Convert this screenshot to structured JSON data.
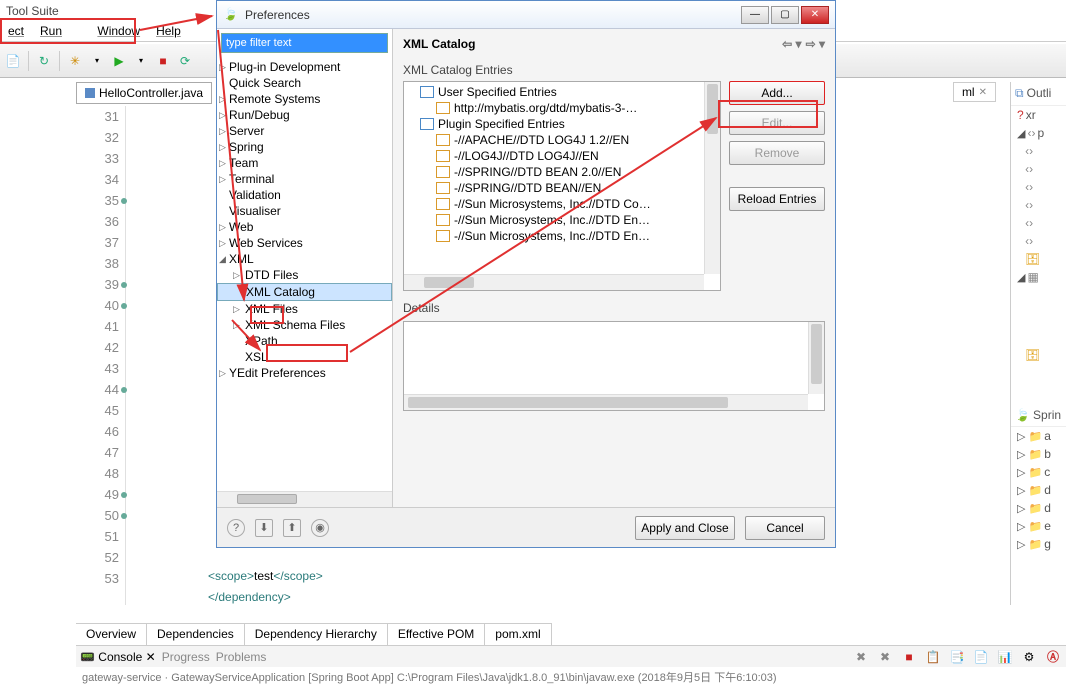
{
  "window": {
    "title": "Tool Suite"
  },
  "menu": [
    "ect",
    "Run",
    "Window",
    "Help"
  ],
  "editor_tab": "HelloController.java",
  "right_tab": "ml",
  "line_numbers": [
    "31",
    "32",
    "33",
    "34",
    "35",
    "36",
    "37",
    "38",
    "39",
    "40",
    "41",
    "42",
    "43",
    "44",
    "45",
    "46",
    "47",
    "48",
    "49",
    "50",
    "51",
    "52",
    "53"
  ],
  "marked_lines": [
    "35",
    "39",
    "40",
    "44",
    "49",
    "50"
  ],
  "code": {
    "l52": {
      "open": "<scope>",
      "txt": "test",
      "close": "</scope>"
    },
    "l53": "</dependency>"
  },
  "bottom_tabs": [
    "Overview",
    "Dependencies",
    "Dependency Hierarchy",
    "Effective POM",
    "pom.xml"
  ],
  "console_tabs": [
    "Console",
    "Progress",
    "Problems"
  ],
  "console_status": "gateway-service · GatewayServiceApplication [Spring Boot App] C:\\Program Files\\Java\\jdk1.8.0_91\\bin\\javaw.exe (2018年9月5日 下午6:10:03)",
  "outline": {
    "title": "Outli",
    "root": "xr",
    "items": [
      "p",
      "‹›",
      "‹›",
      "‹›",
      "‹›",
      "‹›",
      "‹›",
      "‹›"
    ]
  },
  "spring_panel": {
    "title": "Sprin",
    "items": [
      "a",
      "b",
      "c",
      "d",
      "d",
      "e",
      "g"
    ]
  },
  "dialog": {
    "title": "Preferences",
    "filter_text": "type filter text",
    "heading": "XML Catalog",
    "section_entries": "XML Catalog Entries",
    "section_details": "Details",
    "tree": [
      {
        "l": 1,
        "a": "▷",
        "t": "Plug-in Development"
      },
      {
        "l": 1,
        "a": "",
        "t": "Quick Search"
      },
      {
        "l": 1,
        "a": "▷",
        "t": "Remote Systems"
      },
      {
        "l": 1,
        "a": "▷",
        "t": "Run/Debug"
      },
      {
        "l": 1,
        "a": "▷",
        "t": "Server"
      },
      {
        "l": 1,
        "a": "▷",
        "t": "Spring"
      },
      {
        "l": 1,
        "a": "▷",
        "t": "Team"
      },
      {
        "l": 1,
        "a": "▷",
        "t": "Terminal"
      },
      {
        "l": 1,
        "a": "",
        "t": "Validation"
      },
      {
        "l": 1,
        "a": "",
        "t": "Visualiser"
      },
      {
        "l": 1,
        "a": "▷",
        "t": "Web"
      },
      {
        "l": 1,
        "a": "▷",
        "t": "Web Services"
      },
      {
        "l": 1,
        "a": "◢",
        "t": "XML",
        "anno": true
      },
      {
        "l": 2,
        "a": "▷",
        "t": "DTD Files"
      },
      {
        "l": 2,
        "a": "",
        "t": "XML Catalog",
        "sel": true,
        "anno": true
      },
      {
        "l": 2,
        "a": "▷",
        "t": "XML Files"
      },
      {
        "l": 2,
        "a": "▷",
        "t": "XML Schema Files"
      },
      {
        "l": 2,
        "a": "",
        "t": "XPath"
      },
      {
        "l": 2,
        "a": "",
        "t": "XSL"
      },
      {
        "l": 1,
        "a": "▷",
        "t": "YEdit Preferences"
      }
    ],
    "entries": [
      {
        "l": 1,
        "a": "◢",
        "ico": "folder",
        "t": "User Specified Entries"
      },
      {
        "l": 2,
        "ico": "doc",
        "t": "http://mybatis.org/dtd/mybatis-3-…"
      },
      {
        "l": 1,
        "a": "◢",
        "ico": "folder",
        "t": "Plugin Specified Entries"
      },
      {
        "l": 2,
        "ico": "doc",
        "t": "-//APACHE//DTD LOG4J 1.2//EN"
      },
      {
        "l": 2,
        "ico": "doc",
        "t": "-//LOG4J//DTD LOG4J//EN"
      },
      {
        "l": 2,
        "ico": "doc",
        "t": "-//SPRING//DTD BEAN 2.0//EN"
      },
      {
        "l": 2,
        "ico": "doc",
        "t": "-//SPRING//DTD BEAN//EN"
      },
      {
        "l": 2,
        "ico": "doc",
        "t": "-//Sun Microsystems, Inc.//DTD Co…"
      },
      {
        "l": 2,
        "ico": "doc",
        "t": "-//Sun Microsystems, Inc.//DTD En…"
      },
      {
        "l": 2,
        "ico": "doc",
        "t": "-//Sun Microsystems, Inc.//DTD En…"
      }
    ],
    "buttons": {
      "add": "Add...",
      "edit": "Edit...",
      "remove": "Remove",
      "reload": "Reload Entries"
    },
    "footer": {
      "apply": "Apply and Close",
      "cancel": "Cancel"
    }
  }
}
